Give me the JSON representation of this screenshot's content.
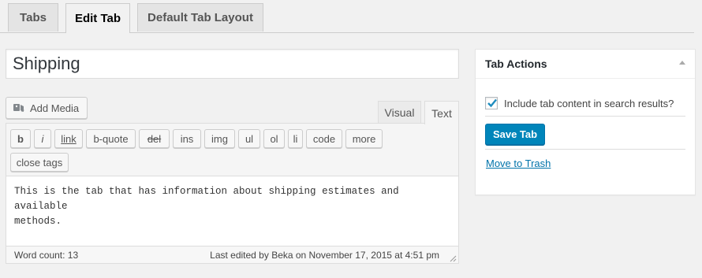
{
  "tabs": [
    {
      "label": "Tabs"
    },
    {
      "label": "Edit Tab"
    },
    {
      "label": "Default Tab Layout"
    }
  ],
  "title_field": {
    "value": "Shipping"
  },
  "editor": {
    "add_media_label": "Add Media",
    "modes": {
      "visual": "Visual",
      "text": "Text"
    },
    "quicktags": [
      "b",
      "i",
      "link",
      "b-quote",
      "del",
      "ins",
      "img",
      "ul",
      "ol",
      "li",
      "code",
      "more",
      "close tags"
    ],
    "content": "This is the tab that has information about shipping estimates and available\nmethods.",
    "word_count": "Word count: 13",
    "last_edited": "Last edited by Beka on November 17, 2015 at 4:51 pm"
  },
  "tab_actions": {
    "title": "Tab Actions",
    "include_search_label": "Include tab content in search results?",
    "include_search_checked": true,
    "save_label": "Save Tab",
    "trash_label": "Move to Trash"
  },
  "colors": {
    "primary_button": "#0085ba",
    "link": "#0073aa",
    "checkmark": "#1e8cbe"
  },
  "icons": {
    "add_media": "media-icon",
    "checkbox": "checkmark-icon",
    "toggle": "collapse-arrow-icon",
    "resize": "resize-handle-icon"
  }
}
